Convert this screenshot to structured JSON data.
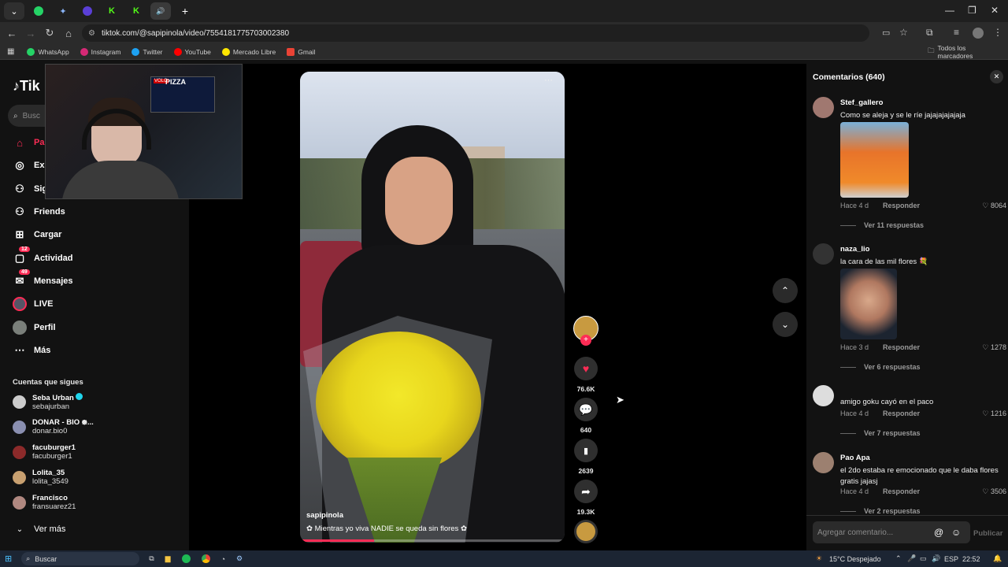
{
  "browser": {
    "tabs": [
      {
        "icon": "chevron-down-icon"
      },
      {
        "icon": "whatsapp-icon"
      },
      {
        "icon": "sparkle-icon"
      },
      {
        "icon": "discord-icon"
      },
      {
        "icon": "kick-icon"
      },
      {
        "icon": "kick-icon"
      },
      {
        "icon": "speaker-icon",
        "active": true
      }
    ],
    "url": "tiktok.com/@sapipinola/video/7554181775703002380",
    "bookmarks": [
      "WhatsApp",
      "Instagram",
      "Twitter",
      "YouTube",
      "Mercado Libre",
      "Gmail"
    ],
    "all_bookmarks": "Todos los marcadores"
  },
  "sidebar": {
    "logo": "Tik",
    "search_placeholder": "Busc",
    "nav": [
      {
        "label": "Pa",
        "icon": "home-icon",
        "color": "#fe2c55"
      },
      {
        "label": "Exp",
        "icon": "compass-icon"
      },
      {
        "label": "Sig",
        "icon": "following-icon"
      },
      {
        "label": "Friends",
        "icon": "friends-icon"
      },
      {
        "label": "Cargar",
        "icon": "upload-icon"
      },
      {
        "label": "Actividad",
        "icon": "activity-icon",
        "badge": "12"
      },
      {
        "label": "Mensajes",
        "icon": "messages-icon",
        "badge": "49"
      },
      {
        "label": "LIVE",
        "icon": "live-icon"
      },
      {
        "label": "Perfil",
        "icon": "profile-icon"
      },
      {
        "label": "Más",
        "icon": "more-icon"
      }
    ],
    "following_title": "Cuentas que sigues",
    "following": [
      {
        "name": "Seba Urban",
        "handle": "sebajurban",
        "verified": true
      },
      {
        "name": "DONAR - BIO ᪥...",
        "handle": "donar.bio0"
      },
      {
        "name": "facuburger1",
        "handle": "facuburger1"
      },
      {
        "name": "Lolita_35",
        "handle": "lolita_3549"
      },
      {
        "name": "Francisco",
        "handle": "fransuarez21"
      }
    ],
    "see_more": "Ver más"
  },
  "webcam": {
    "sign": "PIZZA",
    "sign_prefix": "VOLO"
  },
  "video": {
    "author": "sapipinola",
    "caption": "Mientras yo viva NADIE se queda sin flores",
    "likes": "76.6K",
    "comments": "640",
    "saves": "2639",
    "shares": "19.3K"
  },
  "comments_panel": {
    "title": "Comentarios (640)",
    "items": [
      {
        "user": "Stef_gallero",
        "text": "Como se aleja y se le ríe jajajajajajaja",
        "time": "Hace 4 d",
        "reply": "Responder",
        "likes": "8064",
        "replies": "Ver 11 respuestas"
      },
      {
        "user": "naza_lio",
        "text": "la cara de las mil flores 💐",
        "time": "Hace 3 d",
        "reply": "Responder",
        "likes": "1278",
        "replies": "Ver 6 respuestas"
      },
      {
        "user": "",
        "text": "amigo goku cayó en el paco",
        "time": "Hace 4 d",
        "reply": "Responder",
        "likes": "1216",
        "replies": "Ver 7 respuestas"
      },
      {
        "user": "Pao Apa",
        "text": "el 2do estaba re emocionado que le daba flores gratis jajasj",
        "time": "Hace 4 d",
        "reply": "Responder",
        "likes": "3506",
        "replies": "Ver 2 respuestas"
      }
    ],
    "input_placeholder": "Agregar comentario...",
    "publish": "Publicar"
  },
  "taskbar": {
    "search": "Buscar",
    "weather": "15°C  Despejado",
    "lang": "ESP",
    "time": "22:52"
  }
}
